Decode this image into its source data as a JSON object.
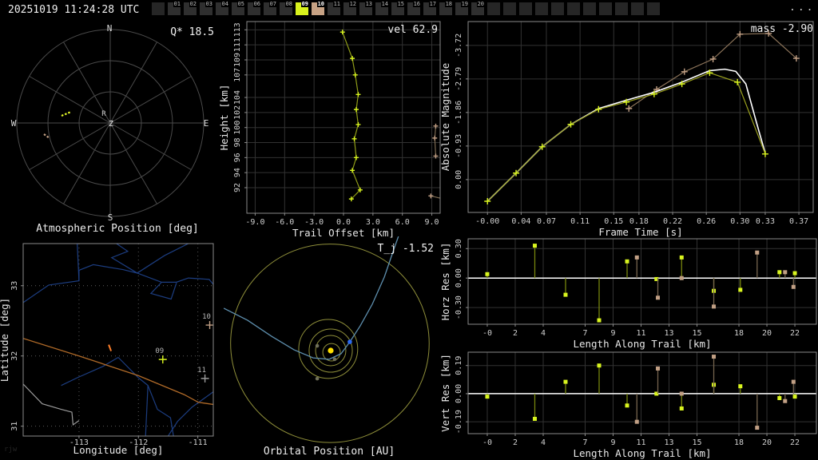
{
  "topbar": {
    "timestamp": "20251019 11:24:28 UTC",
    "overflow_label": "...",
    "cells": [
      "",
      "01",
      "02",
      "03",
      "04",
      "05",
      "06",
      "07",
      "08",
      "09",
      "10",
      "11",
      "12",
      "13",
      "14",
      "15",
      "16",
      "17",
      "18",
      "19",
      "20",
      "",
      "",
      "",
      "",
      "",
      "",
      "",
      "",
      "",
      "",
      ""
    ],
    "highlight_yellow_cell": "09",
    "highlight_tan_cell": "10",
    "colors": {
      "yellow": "#d9f21d",
      "tan": "#c7a284"
    }
  },
  "watermark": "rjw",
  "panels": {
    "atmospheric": {
      "title": "Atmospheric Position [deg]",
      "annotation": "Q* 18.5",
      "compass": {
        "n": "N",
        "e": "E",
        "s": "S",
        "w": "W"
      },
      "center_label": "Z",
      "radiant_label": "R",
      "streaks": [
        {
          "name": "meteor-streak-09",
          "color": "#e6fa28",
          "pts": [
            [
              -61,
              -9
            ],
            [
              -49,
              -14
            ]
          ]
        },
        {
          "name": "meteor-streak-10",
          "color": "#c2a085",
          "pts": [
            [
              -83,
              14
            ],
            [
              -76,
              19
            ]
          ]
        }
      ]
    },
    "orbital": {
      "title": "Orbital Position [AU]",
      "annotation": "T_j -1.52"
    }
  },
  "chart_data": [
    {
      "id": "trail",
      "type": "line",
      "annotation": "vel 62.9",
      "xlabel": "Trail Offset [km]",
      "ylabel": "Height [km]",
      "xlim": [
        -9.85,
        9.85
      ],
      "ylim": [
        88.6,
        114.1
      ],
      "grid": true,
      "xticks": {
        "values": [
          -9,
          -6,
          -3,
          0,
          3,
          6,
          9
        ],
        "labels": [
          "-9.0",
          "-6.0",
          "-3.0",
          "0.0",
          "3.0",
          "6.0",
          "9.0"
        ]
      },
      "yticks": {
        "values": [
          92,
          94,
          96,
          98,
          100,
          102,
          104,
          107,
          109,
          111,
          113
        ],
        "labels": [
          "92",
          "94",
          "96",
          "98",
          "100",
          "102",
          "104",
          "107",
          "109",
          "111",
          "113"
        ]
      },
      "series": [
        {
          "name": "station-09-trail",
          "line": "#8f9c19",
          "marker": "plus",
          "marker_color": "#d9f51f",
          "msize": 3,
          "points": [
            [
              -0.1,
              112.7
            ],
            [
              0.9,
              109.2
            ],
            [
              1.2,
              107.0
            ],
            [
              1.5,
              104.4
            ],
            [
              1.3,
              102.4
            ],
            [
              1.5,
              100.4
            ],
            [
              1.1,
              98.5
            ],
            [
              1.3,
              96.0
            ],
            [
              0.9,
              94.3
            ],
            [
              1.7,
              91.7
            ],
            [
              0.8,
              90.5
            ]
          ]
        },
        {
          "name": "station-10-trail",
          "line": "#7d6b53",
          "marker": "plus",
          "marker_color": "#c2a085",
          "msize": 3,
          "points": [
            [
              9.4,
              100.2
            ],
            [
              9.3,
              98.6
            ],
            [
              9.4,
              96.2
            ]
          ]
        },
        {
          "name": "station-10-trail-end",
          "line": "#7d6b53",
          "marker": "plus",
          "marker_color": "#c2a085",
          "msize": 3,
          "points": [
            [
              8.9,
              90.9
            ],
            [
              10.2,
              90.5
            ]
          ]
        }
      ]
    },
    {
      "id": "magnitude",
      "type": "line",
      "annotation": "mass -2.90",
      "xlabel": "Frame Time [s]",
      "ylabel": "Absolute Magnitude",
      "xlim": [
        -0.023,
        0.387
      ],
      "ylim": [
        0.91,
        -4.38
      ],
      "grid": true,
      "xticks": {
        "values": [
          0,
          0.04,
          0.07,
          0.11,
          0.15,
          0.18,
          0.22,
          0.26,
          0.3,
          0.33,
          0.37
        ],
        "labels": [
          "-0.00",
          "0.04",
          "0.07",
          "0.11",
          "0.15",
          "0.18",
          "0.22",
          "0.26",
          "0.30",
          "0.33",
          "0.37"
        ]
      },
      "yticks": {
        "values": [
          0,
          -0.93,
          -1.86,
          -2.79,
          -3.72
        ],
        "labels": [
          "0.00",
          "-0.93",
          "-1.86",
          "-2.79",
          "-3.72"
        ]
      },
      "series": [
        {
          "name": "station-10-lightcurve",
          "line": "#8a7258",
          "marker": "plus",
          "marker_color": "#c2a085",
          "msize": 4,
          "points": [
            [
              0.168,
              -1.97
            ],
            [
              0.201,
              -2.5
            ],
            [
              0.234,
              -2.99
            ],
            [
              0.268,
              -3.34
            ],
            [
              0.3,
              -4.03
            ],
            [
              0.334,
              -4.05
            ],
            [
              0.367,
              -3.36
            ]
          ]
        },
        {
          "name": "model-fit",
          "line": "#ffffff",
          "width": 1.6,
          "points": [
            [
              0.0,
              0.6
            ],
            [
              0.034,
              -0.18
            ],
            [
              0.065,
              -0.91
            ],
            [
              0.099,
              -1.53
            ],
            [
              0.132,
              -1.97
            ],
            [
              0.165,
              -2.2
            ],
            [
              0.198,
              -2.42
            ],
            [
              0.231,
              -2.7
            ],
            [
              0.264,
              -3.02
            ],
            [
              0.282,
              -3.06
            ],
            [
              0.295,
              -3.0
            ],
            [
              0.307,
              -2.65
            ],
            [
              0.32,
              -1.55
            ],
            [
              0.33,
              -0.73
            ]
          ]
        },
        {
          "name": "station-09-lightcurve",
          "line": "#9aa01e",
          "marker": "plus",
          "marker_color": "#d9f51f",
          "msize": 4,
          "points": [
            [
              0.0,
              0.6
            ],
            [
              0.034,
              -0.18
            ],
            [
              0.065,
              -0.91
            ],
            [
              0.099,
              -1.53
            ],
            [
              0.132,
              -1.95
            ],
            [
              0.165,
              -2.15
            ],
            [
              0.198,
              -2.37
            ],
            [
              0.231,
              -2.65
            ],
            [
              0.264,
              -2.96
            ],
            [
              0.297,
              -2.7
            ],
            [
              0.33,
              -0.71
            ]
          ]
        }
      ]
    },
    {
      "id": "map",
      "type": "map",
      "xlabel": "Longitude [deg]",
      "ylabel": "Latitude [deg]",
      "xlim": [
        -113.94,
        -110.74
      ],
      "ylim": [
        30.86,
        33.6
      ],
      "xticks": {
        "values": [
          -113,
          -112,
          -111
        ],
        "labels": [
          "-113",
          "-112",
          "-111"
        ]
      },
      "yticks": {
        "values": [
          31,
          32,
          33
        ],
        "labels": [
          "31",
          "32",
          "33"
        ]
      },
      "rivers": [
        [
          [
            -113.03,
            33.6
          ],
          [
            -113.0,
            33.07
          ],
          [
            -113.51,
            33.01
          ],
          [
            -113.94,
            32.76
          ]
        ],
        [
          [
            -111.16,
            33.6
          ],
          [
            -111.56,
            33.43
          ],
          [
            -112.02,
            33.18
          ],
          [
            -112.26,
            33.23
          ],
          [
            -112.76,
            33.3
          ],
          [
            -113.0,
            33.22
          ],
          [
            -113.0,
            33.07
          ]
        ],
        [
          [
            -112.02,
            33.18
          ],
          [
            -111.61,
            33.05
          ],
          [
            -111.36,
            33.05
          ],
          [
            -111.16,
            33.11
          ],
          [
            -110.81,
            33.09
          ],
          [
            -110.74,
            33.02
          ]
        ],
        [
          [
            -111.61,
            33.05
          ],
          [
            -111.79,
            32.89
          ],
          [
            -111.45,
            32.81
          ],
          [
            -111.36,
            33.04
          ]
        ],
        [
          [
            -112.37,
            33.6
          ],
          [
            -112.18,
            33.49
          ],
          [
            -112.45,
            33.4
          ],
          [
            -112.02,
            33.18
          ]
        ],
        [
          [
            -112.34,
            31.98
          ],
          [
            -112.6,
            31.85
          ],
          [
            -113.03,
            31.69
          ],
          [
            -113.3,
            31.58
          ]
        ],
        [
          [
            -112.34,
            31.98
          ],
          [
            -112.0,
            31.69
          ],
          [
            -111.84,
            31.58
          ],
          [
            -111.68,
            31.24
          ],
          [
            -111.46,
            31.12
          ],
          [
            -111.41,
            30.86
          ]
        ],
        [
          [
            -110.74,
            31.49
          ],
          [
            -111.1,
            31.27
          ],
          [
            -111.34,
            31.07
          ],
          [
            -111.5,
            30.86
          ]
        ],
        [
          [
            -111.84,
            31.58
          ],
          [
            -111.88,
            30.86
          ]
        ]
      ],
      "border": [
        [
          -113.94,
          31.6
        ],
        [
          -113.62,
          31.32
        ],
        [
          -113.3,
          31.24
        ],
        [
          -113.12,
          31.2
        ],
        [
          -113.1,
          31.02
        ],
        [
          -113.0,
          31.08
        ]
      ],
      "trajectory": [
        [
          -113.94,
          32.25
        ],
        [
          -113.0,
          32.0
        ],
        [
          -112.0,
          31.72
        ],
        [
          -111.23,
          31.45
        ],
        [
          -110.99,
          31.34
        ],
        [
          -110.74,
          31.31
        ]
      ],
      "trajectory_segment": [
        [
          -112.5,
          32.16
        ],
        [
          -112.46,
          32.07
        ]
      ],
      "stations": [
        {
          "id": "10",
          "lon": -110.8,
          "lat": 32.44,
          "color": "#c2a085"
        },
        {
          "id": "09",
          "lon": -111.59,
          "lat": 31.95,
          "color": "#d9f51f"
        },
        {
          "id": "11",
          "lon": -110.88,
          "lat": 31.68,
          "color": "#9a9a9a"
        }
      ]
    },
    {
      "id": "orbital",
      "type": "orbital",
      "au_scale_note": "planet orbits in AU",
      "orbits": [
        {
          "name": "mercury-orbit",
          "r": 0.42,
          "dx": 0.04,
          "dy": -0.08
        },
        {
          "name": "venus-orbit",
          "r": 0.73,
          "dx": 0,
          "dy": 0
        },
        {
          "name": "earth-orbit",
          "r": 1.04,
          "dx": 0,
          "dy": 0
        },
        {
          "name": "mars-orbit",
          "r": 1.42,
          "dx": -0.12,
          "dy": 0.08
        },
        {
          "name": "jupiter-orbit",
          "r": 4.78,
          "dx": -0.04,
          "dy": 0.35
        }
      ],
      "planets": [
        {
          "name": "mercury",
          "x": 0.19,
          "y": -0.42
        },
        {
          "name": "venus",
          "x": -0.65,
          "y": 0.23
        },
        {
          "name": "mars",
          "x": -0.65,
          "y": -1.35
        }
      ],
      "earth": {
        "x": 0.92,
        "y": 0.42
      },
      "sun": {
        "x": 0,
        "y": 0
      },
      "meteor_path": [
        [
          -5.15,
          2.04
        ],
        [
          -4.0,
          1.46
        ],
        [
          -2.85,
          0.69
        ],
        [
          -1.77,
          0.04
        ],
        [
          -0.85,
          -0.35
        ],
        [
          -0.08,
          -0.42
        ],
        [
          0.5,
          -0.15
        ],
        [
          0.92,
          0.42
        ],
        [
          1.42,
          1.19
        ],
        [
          2.0,
          2.23
        ],
        [
          2.58,
          3.54
        ],
        [
          3.04,
          4.88
        ],
        [
          3.26,
          5.5
        ]
      ]
    },
    {
      "id": "horz_res",
      "type": "stem",
      "xlabel": "Length Along Trail [km]",
      "ylabel": "Horz Res [km]",
      "xlim": [
        -1.37,
        23.54
      ],
      "ylim": [
        -0.47,
        0.4
      ],
      "zero_line": true,
      "xticks": {
        "values": [
          0,
          2,
          4,
          7,
          9,
          11,
          13,
          15,
          18,
          20,
          22
        ],
        "labels": [
          "-0",
          "2",
          "4",
          "7",
          "9",
          "11",
          "13",
          "15",
          "18",
          "20",
          "22"
        ]
      },
      "yticks": {
        "values": [
          0.3,
          0.0,
          -0.3
        ],
        "labels": [
          "0.30",
          "0.00",
          "-0.30"
        ]
      },
      "series": [
        {
          "name": "station-09-horz",
          "stem": "#77850d",
          "marker_color": "#d9f51f",
          "points": [
            [
              0.0,
              0.04
            ],
            [
              3.4,
              0.33
            ],
            [
              5.6,
              -0.17
            ],
            [
              8.0,
              -0.43
            ],
            [
              10.0,
              0.17
            ],
            [
              12.1,
              -0.01
            ],
            [
              13.9,
              0.21
            ],
            [
              16.2,
              -0.13
            ],
            [
              18.1,
              -0.12
            ],
            [
              20.9,
              0.06
            ],
            [
              22.0,
              0.05
            ]
          ]
        },
        {
          "name": "station-10-horz",
          "stem": "#75644e",
          "marker_color": "#c2a085",
          "points": [
            [
              10.7,
              0.21
            ],
            [
              12.2,
              -0.2
            ],
            [
              13.9,
              0.0
            ],
            [
              16.2,
              -0.29
            ],
            [
              19.3,
              0.26
            ],
            [
              21.3,
              0.06
            ],
            [
              21.9,
              -0.09
            ]
          ]
        }
      ]
    },
    {
      "id": "vert_res",
      "type": "stem",
      "xlabel": "Length Along Trail [km]",
      "ylabel": "Vert Res [km]",
      "xlim": [
        -1.37,
        23.54
      ],
      "ylim": [
        -0.27,
        0.28
      ],
      "zero_line": true,
      "xticks": {
        "values": [
          0,
          2,
          4,
          7,
          9,
          11,
          13,
          15,
          18,
          20,
          22
        ],
        "labels": [
          "-0",
          "2",
          "4",
          "7",
          "9",
          "11",
          "13",
          "15",
          "18",
          "20",
          "22"
        ]
      },
      "yticks": {
        "values": [
          0.19,
          0.0,
          -0.19
        ],
        "labels": [
          "0.19",
          "0.00",
          "-0.19"
        ]
      },
      "series": [
        {
          "name": "station-09-vert",
          "stem": "#77850d",
          "marker_color": "#d9f51f",
          "points": [
            [
              0.0,
              -0.02
            ],
            [
              3.4,
              -0.17
            ],
            [
              5.6,
              0.08
            ],
            [
              8.0,
              0.19
            ],
            [
              10.0,
              -0.08
            ],
            [
              12.1,
              0.0
            ],
            [
              13.9,
              -0.1
            ],
            [
              16.2,
              0.06
            ],
            [
              18.1,
              0.05
            ],
            [
              20.9,
              -0.03
            ],
            [
              22.0,
              -0.02
            ]
          ]
        },
        {
          "name": "station-10-vert",
          "stem": "#75644e",
          "marker_color": "#c2a085",
          "points": [
            [
              10.7,
              -0.19
            ],
            [
              12.2,
              0.17
            ],
            [
              13.9,
              0.0
            ],
            [
              16.2,
              0.25
            ],
            [
              19.3,
              -0.23
            ],
            [
              21.3,
              -0.05
            ],
            [
              21.9,
              0.08
            ]
          ]
        }
      ]
    }
  ]
}
